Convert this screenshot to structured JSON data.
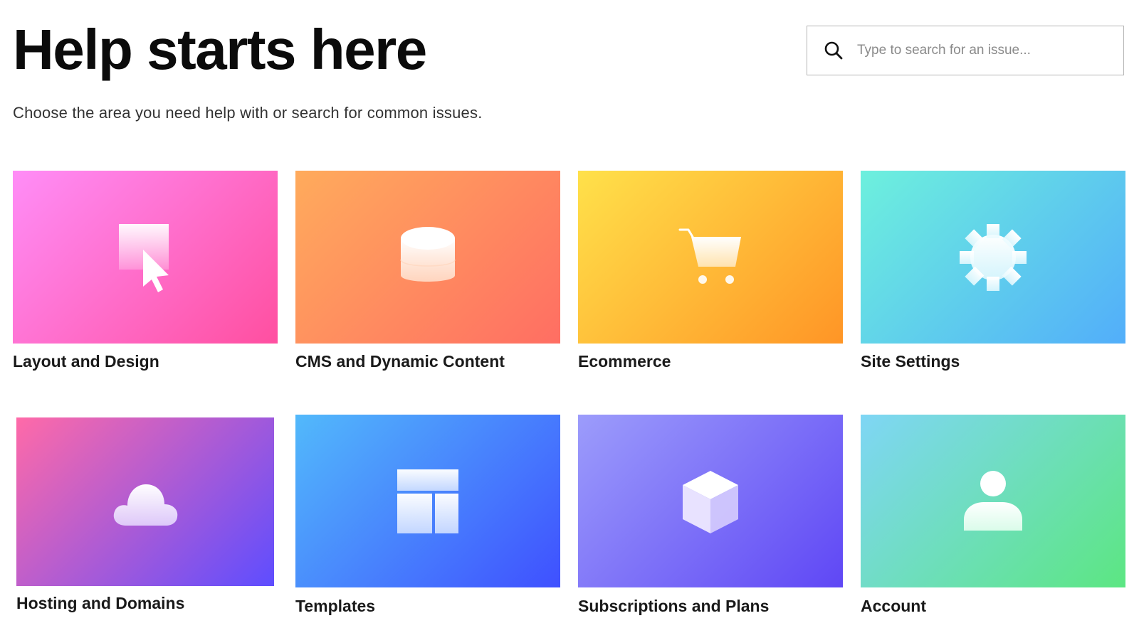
{
  "header": {
    "title": "Help starts here",
    "subtitle": "Choose the area you need help with or search for common issues."
  },
  "search": {
    "placeholder": "Type to search for an issue...",
    "value": "",
    "icon": "search-icon"
  },
  "categories": [
    {
      "label": "Layout and Design",
      "icon": "cursor-select-icon",
      "gradient": [
        "#ff8df7",
        "#ff4fa0"
      ]
    },
    {
      "label": "CMS and Dynamic Content",
      "icon": "database-icon",
      "gradient": [
        "#ffab5c",
        "#ff6e63"
      ]
    },
    {
      "label": "Ecommerce",
      "icon": "shopping-cart-icon",
      "gradient": [
        "#ffe14a",
        "#ff9526"
      ]
    },
    {
      "label": "Site Settings",
      "icon": "gear-icon",
      "gradient": [
        "#6df0dd",
        "#52aefa"
      ]
    },
    {
      "label": "Hosting and Domains",
      "icon": "cloud-icon",
      "gradient": [
        "#ff6aa8",
        "#5e4dff"
      ]
    },
    {
      "label": "Templates",
      "icon": "layout-template-icon",
      "gradient": [
        "#52b9fb",
        "#3f50ff"
      ]
    },
    {
      "label": "Subscriptions and Plans",
      "icon": "cube-icon",
      "gradient": [
        "#9c9cfb",
        "#5f47f5"
      ]
    },
    {
      "label": "Account",
      "icon": "user-icon",
      "gradient": [
        "#7fd6f5",
        "#5ce682"
      ]
    }
  ]
}
